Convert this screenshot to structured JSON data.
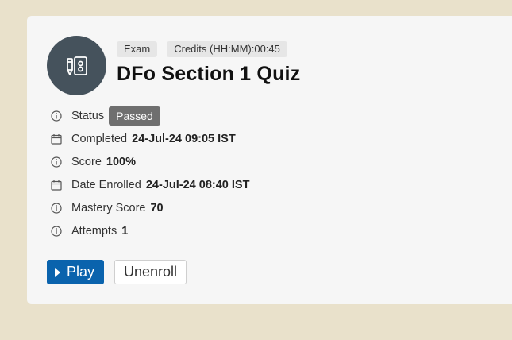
{
  "header": {
    "tags": [
      "Exam",
      "Credits (HH:MM):00:45"
    ],
    "title": "DFo Section 1 Quiz",
    "icon": "exam-pencil-icon"
  },
  "details": {
    "status": {
      "label": "Status",
      "value": "Passed",
      "icon": "info-icon"
    },
    "completed": {
      "label": "Completed",
      "value": "24-Jul-24 09:05 IST",
      "icon": "calendar-icon"
    },
    "score": {
      "label": "Score",
      "value": "100%",
      "icon": "info-icon"
    },
    "date_enrolled": {
      "label": "Date Enrolled",
      "value": "24-Jul-24 08:40 IST",
      "icon": "calendar-icon"
    },
    "mastery_score": {
      "label": "Mastery Score",
      "value": "70",
      "icon": "info-icon"
    },
    "attempts": {
      "label": "Attempts",
      "value": "1",
      "icon": "info-icon"
    }
  },
  "actions": {
    "play_label": "Play",
    "unenroll_label": "Unenroll"
  },
  "colors": {
    "background": "#e9e1cb",
    "card": "#f6f6f6",
    "avatar": "#45525c",
    "primary": "#0a63ad",
    "badge": "#6f6f6f"
  }
}
